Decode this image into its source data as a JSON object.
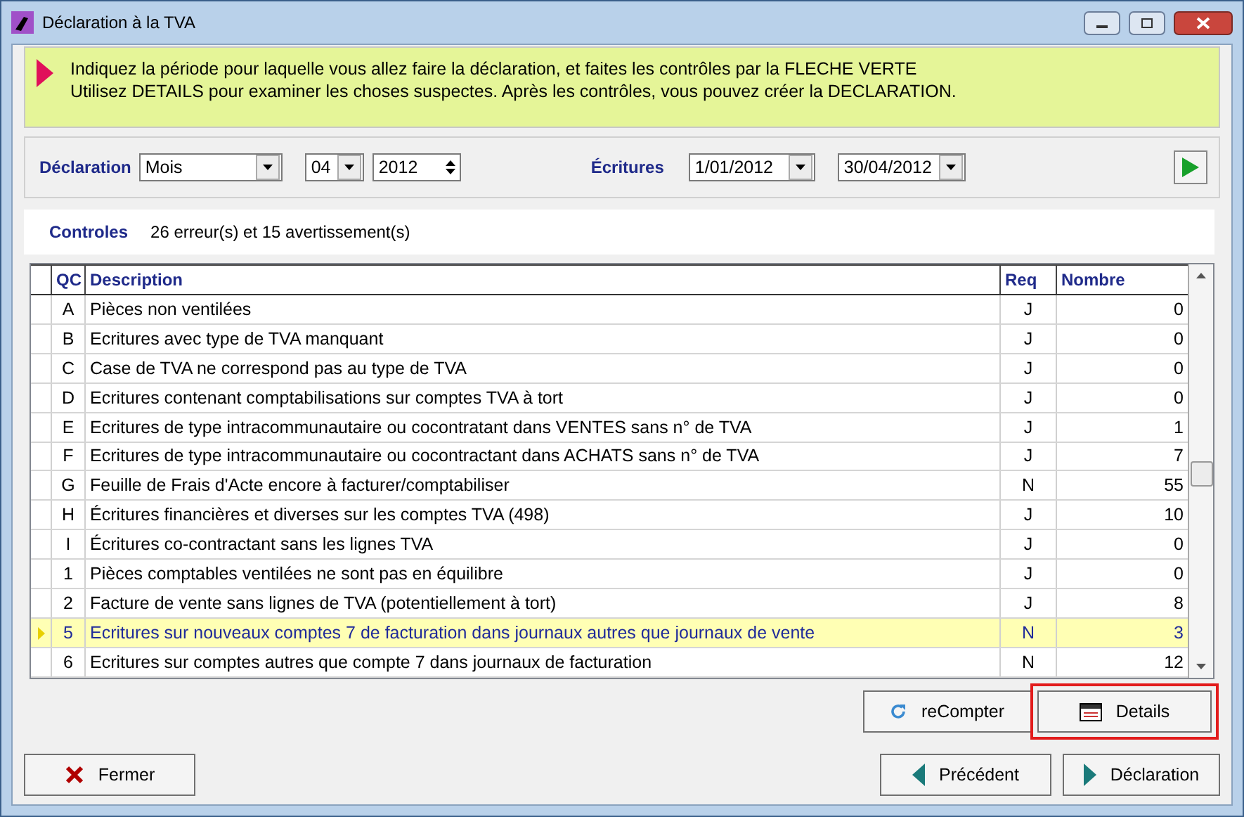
{
  "window": {
    "title": "Déclaration à la TVA"
  },
  "message": {
    "lines": [
      "Indiquez la période pour laquelle vous allez faire la déclaration, et faites les contrôles par la FLECHE VERTE",
      "Utilisez DETAILS pour examiner les choses suspectes.  Après les contrôles, vous pouvez créer la DECLARATION."
    ]
  },
  "filters": {
    "declaration_label": "Déclaration",
    "period": "Mois",
    "month": "04",
    "year": "2012",
    "ecritures_label": "Écritures",
    "date_from": "1/01/2012",
    "date_to": "30/04/2012"
  },
  "controls": {
    "label": "Controles",
    "summary": "26 erreur(s) et 15 avertissement(s)"
  },
  "table": {
    "columns": [
      "QC",
      "Description",
      "Req",
      "Nombre"
    ],
    "rows": [
      {
        "qc": "A",
        "description": "Pièces non ventilées",
        "req": "J",
        "nombre": "0",
        "selected": false
      },
      {
        "qc": "B",
        "description": "Ecritures avec type de TVA manquant",
        "req": "J",
        "nombre": "0",
        "selected": false
      },
      {
        "qc": "C",
        "description": "Case de TVA ne correspond pas au type de TVA",
        "req": "J",
        "nombre": "0",
        "selected": false
      },
      {
        "qc": "D",
        "description": "Ecritures contenant comptabilisations sur comptes TVA à tort",
        "req": "J",
        "nombre": "0",
        "selected": false
      },
      {
        "qc": "E",
        "description": "Ecritures de type intracommunautaire ou cocontratant dans VENTES sans n° de TVA",
        "req": "J",
        "nombre": "1",
        "selected": false
      },
      {
        "qc": "F",
        "description": "Ecritures de type intracommunautaire ou cocontractant dans ACHATS sans n° de TVA",
        "req": "J",
        "nombre": "7",
        "selected": false
      },
      {
        "qc": "G",
        "description": "Feuille de Frais d'Acte encore à facturer/comptabiliser",
        "req": "N",
        "nombre": "55",
        "selected": false
      },
      {
        "qc": "H",
        "description": "Écritures financières et diverses sur les comptes TVA (498)",
        "req": "J",
        "nombre": "10",
        "selected": false
      },
      {
        "qc": "I",
        "description": "Écritures co-contractant sans les lignes TVA",
        "req": "J",
        "nombre": "0",
        "selected": false
      },
      {
        "qc": "1",
        "description": "Pièces comptables ventilées ne sont pas en équilibre",
        "req": "J",
        "nombre": "0",
        "selected": false
      },
      {
        "qc": "2",
        "description": "Facture de vente sans lignes de TVA (potentiellement à tort)",
        "req": "J",
        "nombre": "8",
        "selected": false
      },
      {
        "qc": "5",
        "description": "Ecritures sur nouveaux comptes 7 de facturation dans journaux autres que journaux de vente",
        "req": "N",
        "nombre": "3",
        "selected": true
      },
      {
        "qc": "6",
        "description": "Ecritures sur comptes autres que compte 7 dans journaux de facturation",
        "req": "N",
        "nombre": "12",
        "selected": false
      }
    ]
  },
  "actions": [
    {
      "label": "reCompter",
      "kind": "refresh",
      "focused": false
    },
    {
      "label": "Details",
      "kind": "details",
      "focused": true
    }
  ],
  "footer": [
    {
      "label": "Fermer",
      "kind": "close"
    },
    {
      "label": "Précédent",
      "kind": "prev"
    },
    {
      "label": "Déclaration",
      "kind": "next"
    }
  ]
}
